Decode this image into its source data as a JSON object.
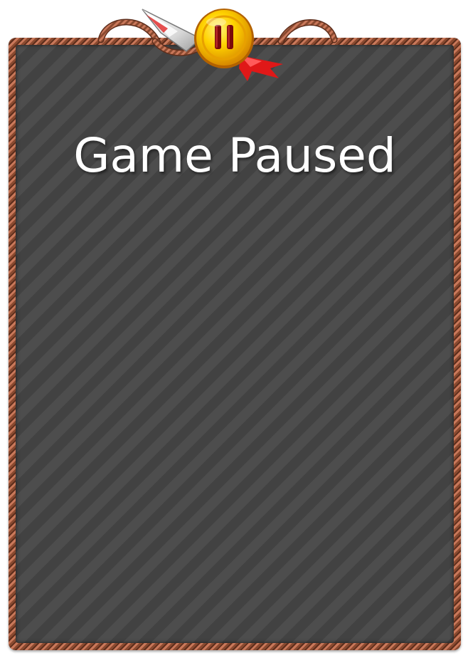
{
  "screen": {
    "title": "Game Paused"
  },
  "controls": {
    "pause_icon": "pause-icon"
  },
  "colors": {
    "slate": "#474747",
    "frame": "#8a4a30",
    "coin": "#f5c400",
    "ribbon": "#e01818",
    "title_text": "#ffffff"
  }
}
